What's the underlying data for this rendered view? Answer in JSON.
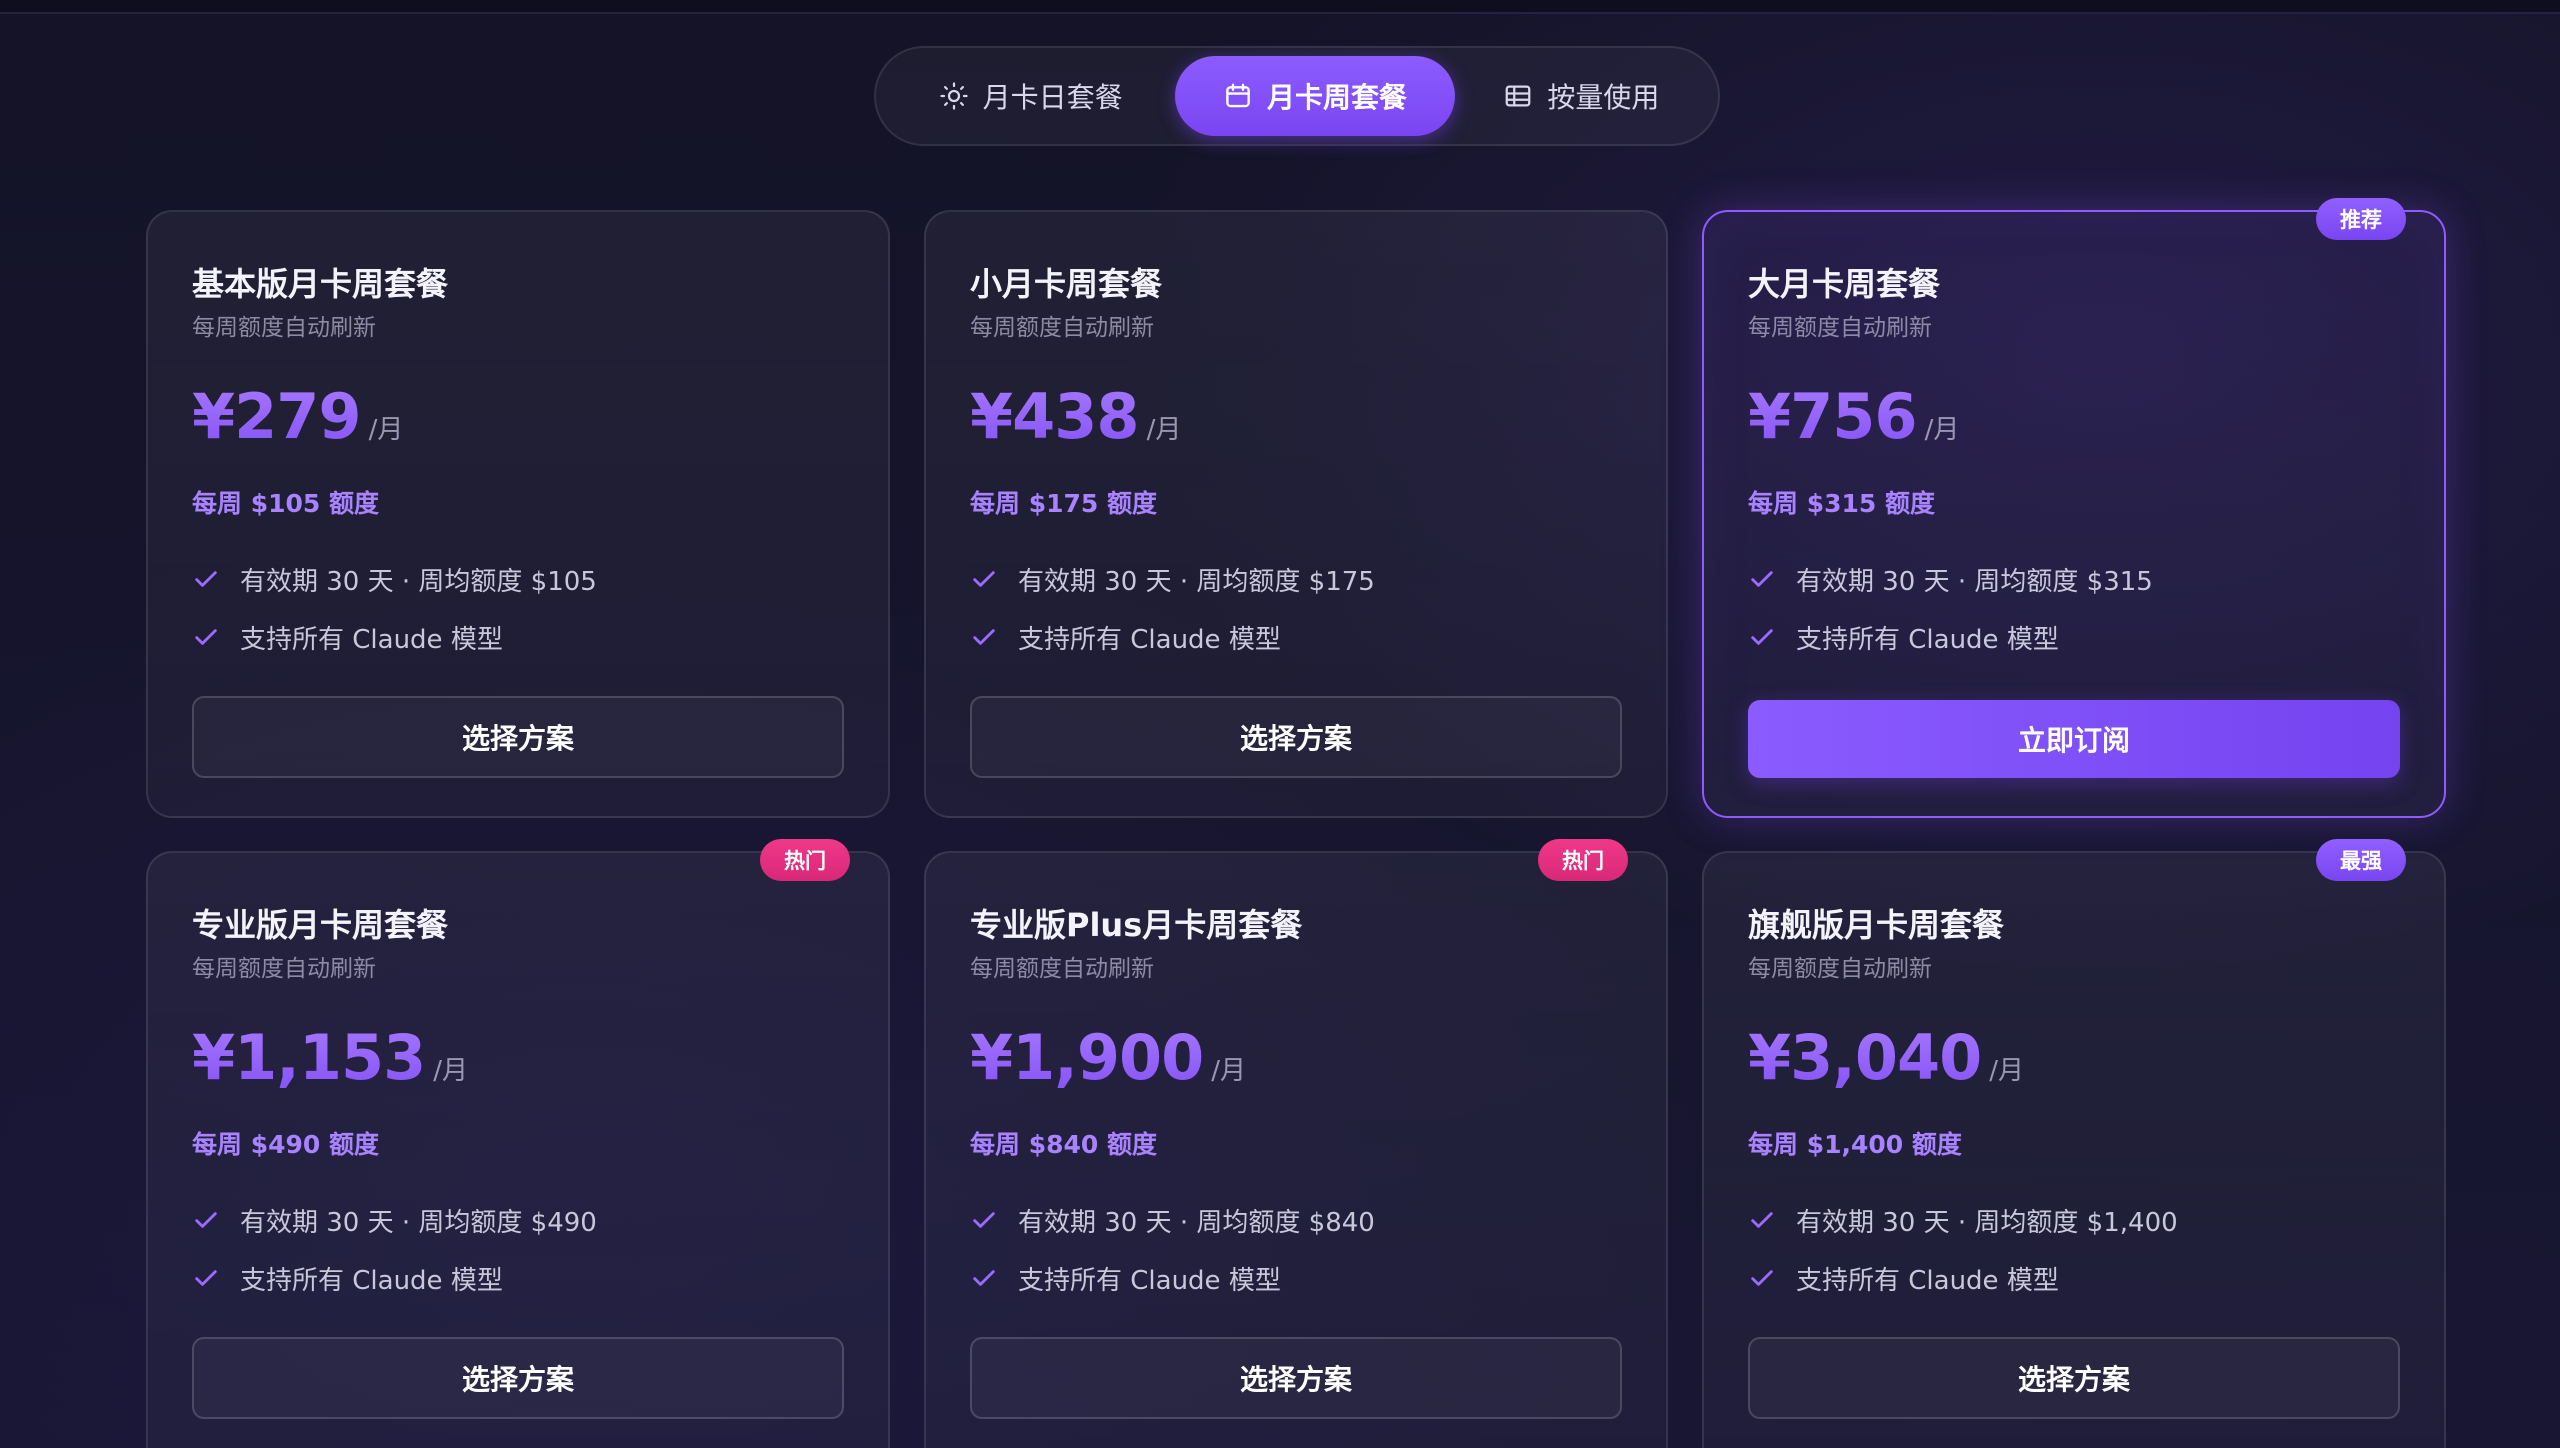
{
  "tabs": [
    {
      "label": "月卡日套餐",
      "icon": "sun-icon",
      "active": false
    },
    {
      "label": "月卡周套餐",
      "icon": "calendar-icon",
      "active": true
    },
    {
      "label": "按量使用",
      "icon": "table-icon",
      "active": false
    }
  ],
  "colors": {
    "accent": "#8c5cff",
    "hot_badge": "#e8307f",
    "check": "#9a6bff"
  },
  "plans": [
    {
      "name": "基本版月卡周套餐",
      "subtitle": "每周额度自动刷新",
      "price": "¥279",
      "per": "/月",
      "quota": "每周 $105 额度",
      "features": [
        "有效期 30 天 · 周均额度 $105",
        "支持所有 Claude 模型"
      ],
      "button": "选择方案",
      "badge": ""
    },
    {
      "name": "小月卡周套餐",
      "subtitle": "每周额度自动刷新",
      "price": "¥438",
      "per": "/月",
      "quota": "每周 $175 额度",
      "features": [
        "有效期 30 天 · 周均额度 $175",
        "支持所有 Claude 模型"
      ],
      "button": "选择方案",
      "badge": ""
    },
    {
      "name": "大月卡周套餐",
      "subtitle": "每周额度自动刷新",
      "price": "¥756",
      "per": "/月",
      "quota": "每周 $315 额度",
      "features": [
        "有效期 30 天 · 周均额度 $315",
        "支持所有 Claude 模型"
      ],
      "button": "立即订阅",
      "badge": "推荐"
    },
    {
      "name": "专业版月卡周套餐",
      "subtitle": "每周额度自动刷新",
      "price": "¥1,153",
      "per": "/月",
      "quota": "每周 $490 额度",
      "features": [
        "有效期 30 天 · 周均额度 $490",
        "支持所有 Claude 模型"
      ],
      "button": "选择方案",
      "badge": "热门"
    },
    {
      "name": "专业版Plus月卡周套餐",
      "subtitle": "每周额度自动刷新",
      "price": "¥1,900",
      "per": "/月",
      "quota": "每周 $840 额度",
      "features": [
        "有效期 30 天 · 周均额度 $840",
        "支持所有 Claude 模型"
      ],
      "button": "选择方案",
      "badge": "热门"
    },
    {
      "name": "旗舰版月卡周套餐",
      "subtitle": "每周额度自动刷新",
      "price": "¥3,040",
      "per": "/月",
      "quota": "每周 $1,400 额度",
      "features": [
        "有效期 30 天 · 周均额度 $1,400",
        "支持所有 Claude 模型"
      ],
      "button": "选择方案",
      "badge": "最强"
    }
  ]
}
